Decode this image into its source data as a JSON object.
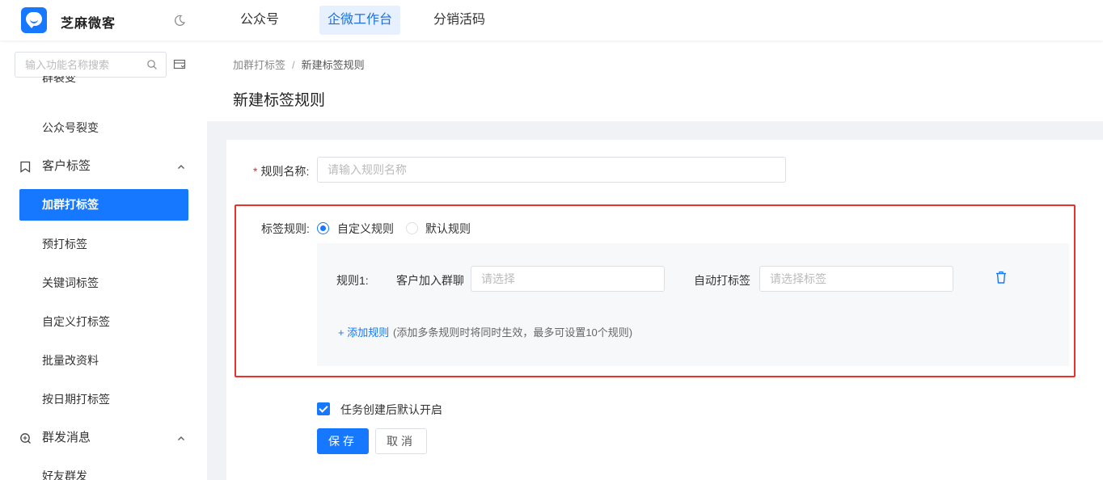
{
  "app": {
    "title": "芝麻微客"
  },
  "topnav": {
    "items": [
      {
        "label": "公众号",
        "active": false
      },
      {
        "label": "企微工作台",
        "active": true
      },
      {
        "label": "分销活码",
        "active": false
      }
    ]
  },
  "sidebar": {
    "search_placeholder": "输入功能名称搜索",
    "partial_top": "群裂变",
    "items": [
      {
        "label": "公众号裂变",
        "type": "sub"
      },
      {
        "label": "客户标签",
        "type": "group",
        "icon": "tag-icon"
      },
      {
        "label": "加群打标签",
        "type": "sub",
        "active": true
      },
      {
        "label": "预打标签",
        "type": "sub"
      },
      {
        "label": "关键词标签",
        "type": "sub"
      },
      {
        "label": "自定义打标签",
        "type": "sub"
      },
      {
        "label": "批量改资料",
        "type": "sub"
      },
      {
        "label": "按日期打标签",
        "type": "sub"
      },
      {
        "label": "群发消息",
        "type": "group",
        "icon": "broadcast-icon"
      },
      {
        "label": "好友群发",
        "type": "sub"
      }
    ]
  },
  "breadcrumb": {
    "parent": "加群打标签",
    "separator": "/",
    "current": "新建标签规则"
  },
  "page_title": "新建标签规则",
  "form": {
    "rule_name": {
      "label": "规则名称:",
      "placeholder": "请输入规则名称",
      "value": ""
    },
    "tag_rule": {
      "label": "标签规则:",
      "options": [
        {
          "label": "自定义规则",
          "checked": true
        },
        {
          "label": "默认规则",
          "checked": false
        }
      ]
    },
    "rule1": {
      "label": "规则1:",
      "group_label": "客户加入群聊",
      "group_placeholder": "请选择",
      "tag_label": "自动打标签",
      "tag_placeholder": "请选择标签"
    },
    "add_rule": {
      "label": "+ 添加规则",
      "hint": "(添加多条规则时将同时生效，最多可设置10个规则)"
    },
    "auto_enable": {
      "label": "任务创建后默认开启",
      "checked": true
    },
    "buttons": {
      "save": "保存",
      "cancel": "取消"
    }
  },
  "colors": {
    "primary": "#1677ff",
    "highlight_border": "#e8322c",
    "nav_active_bg": "#e6f0fe"
  }
}
